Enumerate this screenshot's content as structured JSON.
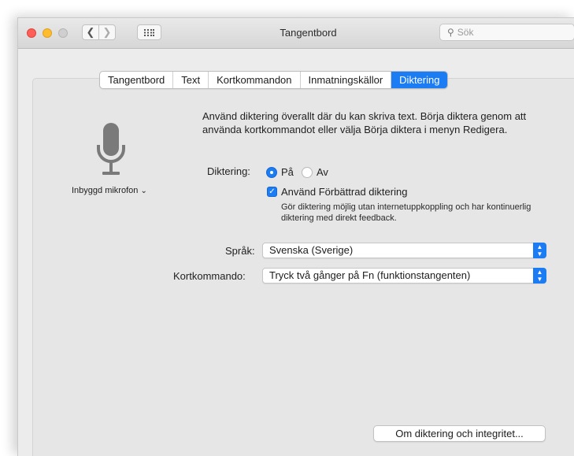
{
  "window": {
    "title": "Tangentbord",
    "search_placeholder": "Sök"
  },
  "tabs": [
    {
      "label": "Tangentbord",
      "active": false
    },
    {
      "label": "Text",
      "active": false
    },
    {
      "label": "Kortkommandon",
      "active": false
    },
    {
      "label": "Inmatningskällor",
      "active": false
    },
    {
      "label": "Diktering",
      "active": true
    }
  ],
  "microphone": {
    "icon": "microphone-icon",
    "label": "Inbyggd mikrofon"
  },
  "description": "Använd diktering överallt där du kan skriva text. Börja diktera genom att använda kortkommandot eller välja Börja diktera i menyn Redigera.",
  "dictation": {
    "label": "Diktering:",
    "on_label": "På",
    "off_label": "Av",
    "selected": "På"
  },
  "enhanced": {
    "label": "Använd Förbättrad diktering",
    "checked": true,
    "note": "Gör diktering möjlig utan internetuppkoppling och har kontinuerlig diktering med direkt feedback."
  },
  "language": {
    "label": "Språk:",
    "value": "Svenska (Sverige)"
  },
  "shortcut": {
    "label": "Kortkommando:",
    "value": "Tryck två gånger på Fn (funktionstangenten)"
  },
  "about_button": "Om diktering och integritet...",
  "colors": {
    "accent": "#1c7cf4",
    "close": "#fe5f57",
    "minimize": "#febc2e"
  }
}
